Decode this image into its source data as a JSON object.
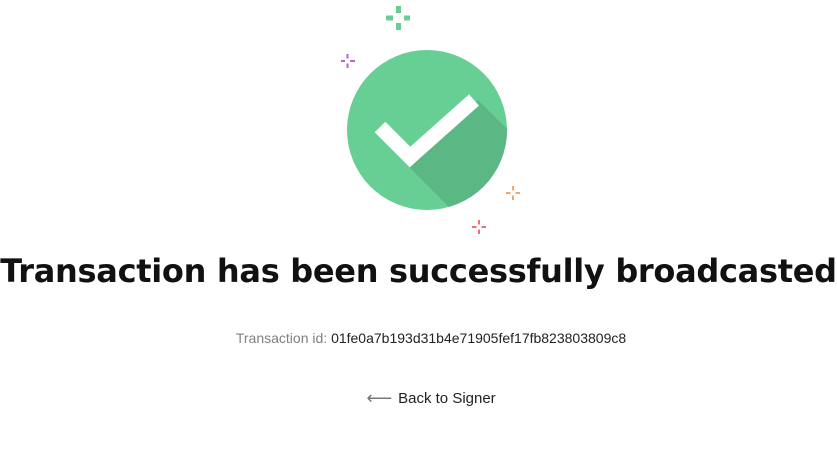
{
  "headline": "Transaction has been successfully broadcasted",
  "transaction": {
    "label": "Transaction id:",
    "id": "01fe0a7b193d31b4e71905fef17fb823803809c8"
  },
  "back_link": {
    "label": "Back to Signer",
    "icon": "arrow-left-icon"
  },
  "illustration": {
    "icon": "check-circle-icon",
    "circle_color": "#67CF93",
    "shadow_color": "#5BB784",
    "check_color": "#FFFFFF",
    "sparkle_colors": {
      "green": "#67CF93",
      "purple": "#B565D4",
      "orange": "#F2A86A",
      "red": "#E8747A"
    }
  }
}
